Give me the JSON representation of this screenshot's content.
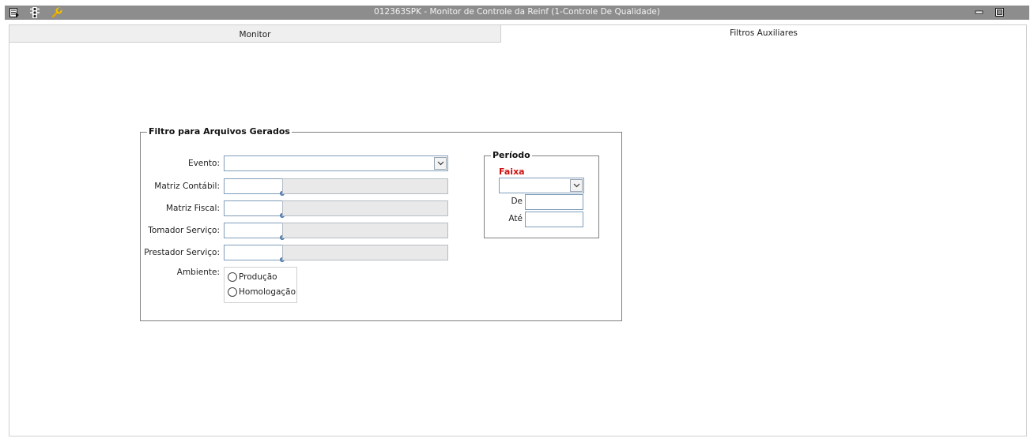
{
  "window": {
    "title": "012363SPK - Monitor de Controle da Reinf (1-Controle De Qualidade)",
    "icons": [
      "menu-icon",
      "traffic-light-icon",
      "wrench-icon"
    ],
    "controls": [
      "minimize-icon",
      "maximize-icon"
    ]
  },
  "tabs": [
    {
      "label": "Monitor",
      "active": false
    },
    {
      "label": "Filtros Auxiliares",
      "active": true
    }
  ],
  "filter_group": {
    "legend": "Filtro para Arquivos Gerados",
    "fields": {
      "evento": {
        "label": "Evento:",
        "value": ""
      },
      "matriz_contabil": {
        "label": "Matriz Contábil:",
        "value": "",
        "description": ""
      },
      "matriz_fiscal": {
        "label": "Matriz Fiscal:",
        "value": "",
        "description": ""
      },
      "tomador": {
        "label": "Tomador Serviço:",
        "value": "",
        "description": ""
      },
      "prestador": {
        "label": "Prestador Serviço:",
        "value": "",
        "description": ""
      }
    },
    "ambiente": {
      "label": "Ambiente:",
      "options": [
        "Produção",
        "Homologação"
      ],
      "selected": null
    }
  },
  "period_group": {
    "legend": "Período",
    "faixa_label": "Faixa",
    "faixa_value": "",
    "de_label": "De",
    "ate_label": "Até",
    "de_value": "",
    "ate_value": ""
  },
  "colors": {
    "titlebar": "#8d8d8d",
    "faixa": "#d01010",
    "input_border": "#7f9db9"
  }
}
